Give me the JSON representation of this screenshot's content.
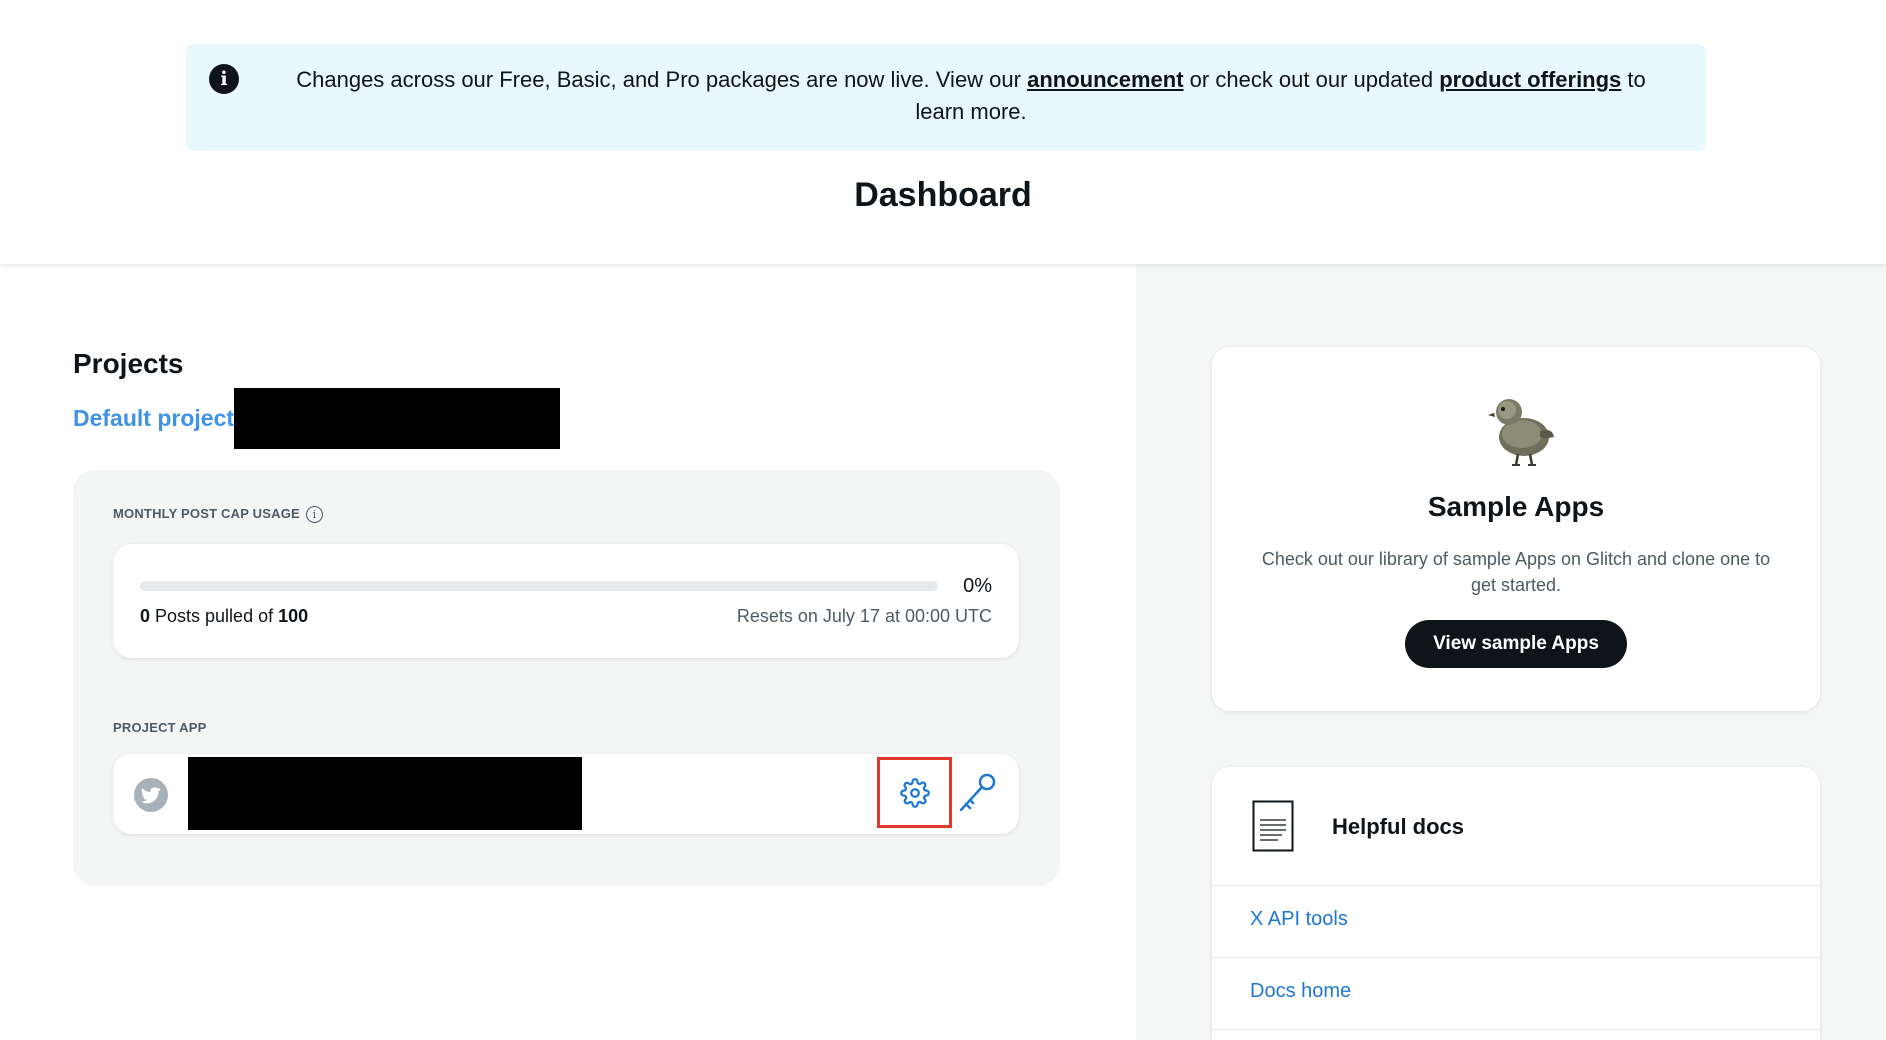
{
  "banner": {
    "icon": "info-icon",
    "text_before": "Changes across our Free, Basic, and Pro packages are now live. View our ",
    "link_announcement": "announcement",
    "text_middle": " or check out our updated ",
    "link_offerings": "product offerings",
    "text_after": " to learn more.",
    "background": "#e9f8fd"
  },
  "page": {
    "title": "Dashboard"
  },
  "projects": {
    "heading": "Projects",
    "project_link": "Default project-",
    "usage": {
      "label": "MONTHLY POST CAP USAGE",
      "percent_label": "0%",
      "percent": 0,
      "posts_pulled": "0",
      "posts_text": " Posts pulled of ",
      "posts_cap": "100",
      "resets": "Resets on July 17 at 00:00 UTC"
    },
    "app": {
      "label": "PROJECT APP",
      "avatar_icon": "twitter-bird-icon",
      "settings_icon": "gear-icon",
      "keys_icon": "key-icon"
    }
  },
  "sample_apps": {
    "image": "chick-image",
    "title": "Sample Apps",
    "description": "Check out our library of sample Apps on Glitch and clone one to get started.",
    "button": "View sample Apps"
  },
  "helpful_docs": {
    "icon": "document-icon",
    "title": "Helpful docs",
    "links": [
      "X API tools",
      "Docs home"
    ]
  },
  "colors": {
    "accent": "#1d9bf0",
    "link": "#3f92e4",
    "highlight_box": "#e0382b"
  }
}
